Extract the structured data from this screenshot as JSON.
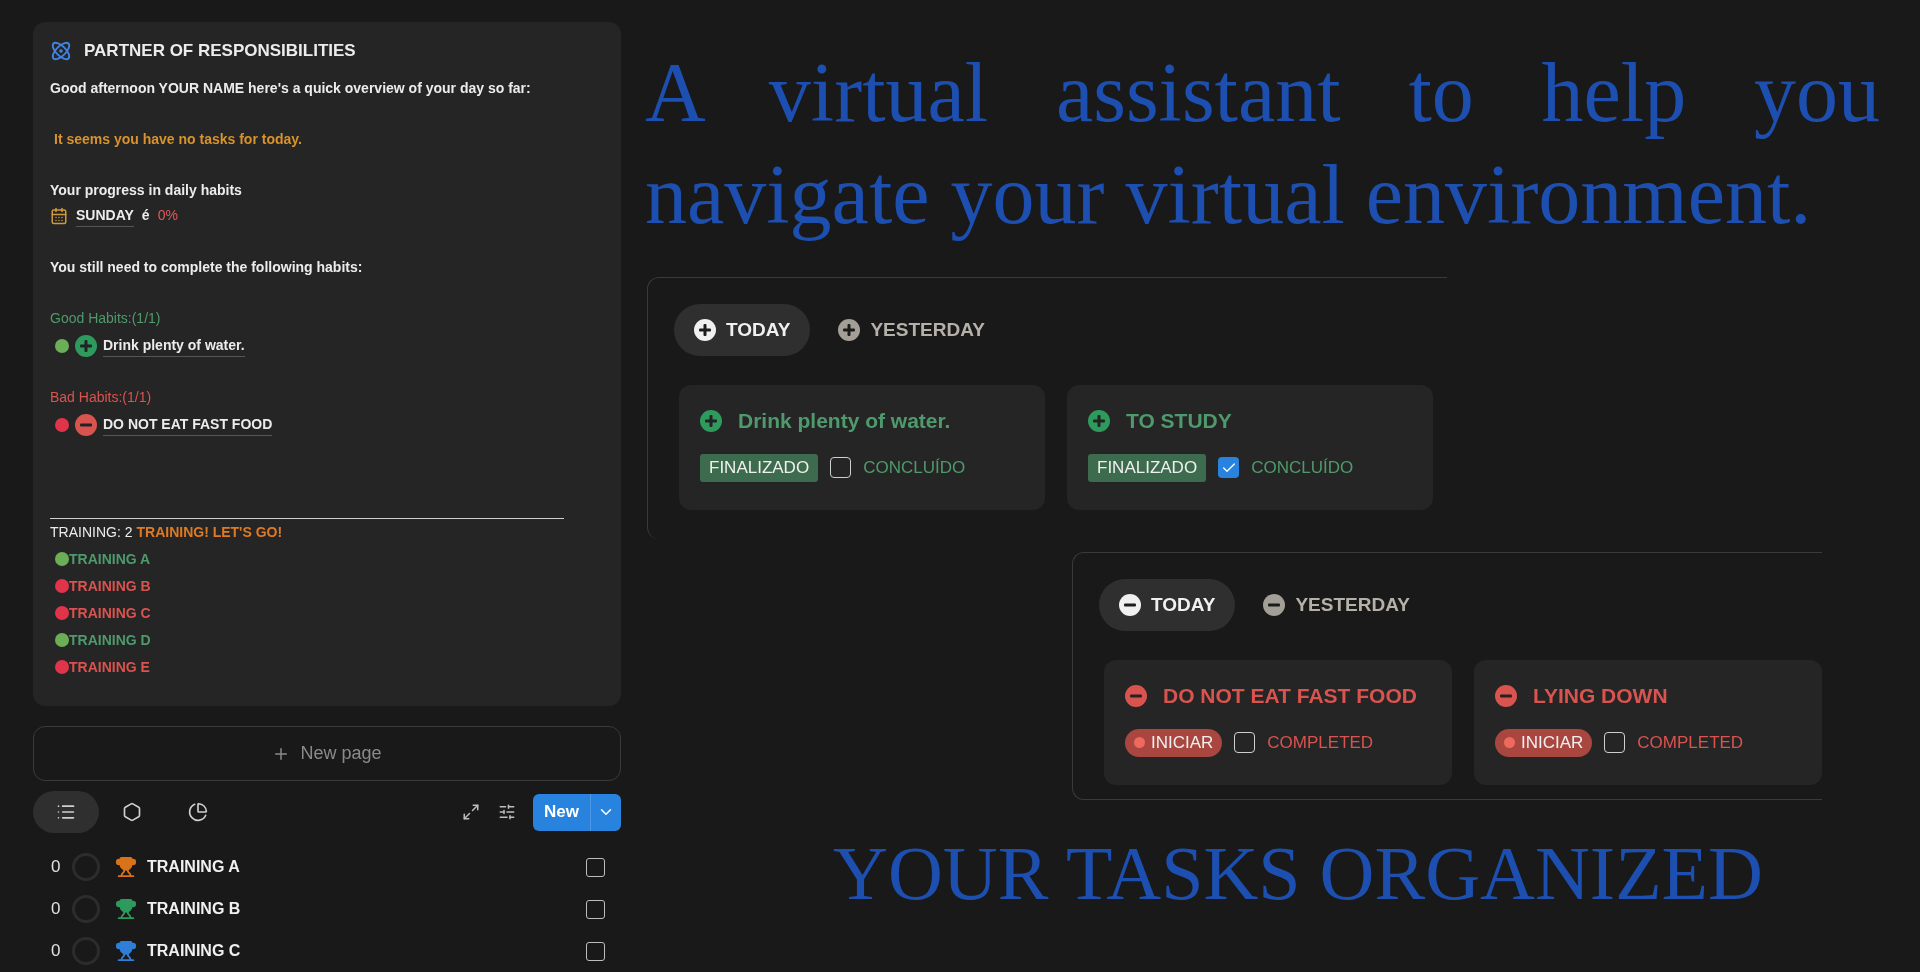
{
  "assistant": {
    "title": "PARTNER OF RESPONSIBILITIES",
    "greeting": "Good afternoon YOUR NAME here's a quick overview of your day so far:",
    "no_tasks": "It seems you have no tasks for today.",
    "progress_label": "Your progress in daily habits",
    "progress": {
      "day": "SUNDAY",
      "connector": "é",
      "percent": "0%"
    },
    "remaining_label": "You still need to complete the following habits:",
    "habit_groups": [
      {
        "kind": "good",
        "label": "Good Habits:(1/1)",
        "items": [
          "Drink plenty of water."
        ]
      },
      {
        "kind": "bad",
        "label": "Bad Habits:(1/1)",
        "items": [
          "DO NOT EAT FAST FOOD"
        ]
      }
    ],
    "training": {
      "label": "TRAINING: 2",
      "cheer": "TRAINING! LET'S GO!",
      "items": [
        {
          "name": "TRAINING A",
          "done": true
        },
        {
          "name": "TRAINING B",
          "done": false
        },
        {
          "name": "TRAINING C",
          "done": false
        },
        {
          "name": "TRAINING D",
          "done": true
        },
        {
          "name": "TRAINING E",
          "done": false
        }
      ]
    }
  },
  "new_page_button": "New page",
  "views": [
    {
      "kind": "list",
      "selected": true
    },
    {
      "kind": "gallery",
      "selected": false
    },
    {
      "kind": "chart",
      "selected": false
    }
  ],
  "new_button": "New",
  "rows": [
    {
      "count": "0",
      "name": "TRAINING A",
      "color": "#d9731a",
      "checked": false
    },
    {
      "count": "0",
      "name": "TRAINING B",
      "color": "#2e9a5e",
      "checked": false
    },
    {
      "count": "0",
      "name": "TRAINING C",
      "color": "#2f7fd8",
      "checked": false
    }
  ],
  "headline": "A virtual assistant to help you navigate your virtual environment.",
  "panels": [
    {
      "kind": "good",
      "tabs": [
        {
          "label": "TODAY",
          "selected": true
        },
        {
          "label": "YESTERDAY",
          "selected": false
        }
      ],
      "cards": [
        {
          "title": "Drink plenty of water.",
          "badge": "FINALIZADO",
          "check_label": "CONCLUÍDO",
          "checked": false
        },
        {
          "title": "TO STUDY",
          "badge": "FINALIZADO",
          "check_label": "CONCLUÍDO",
          "checked": true
        }
      ]
    },
    {
      "kind": "bad",
      "tabs": [
        {
          "label": "TODAY",
          "selected": true
        },
        {
          "label": "YESTERDAY",
          "selected": false
        }
      ],
      "cards": [
        {
          "title": "DO NOT EAT FAST FOOD",
          "badge": "INICIAR",
          "check_label": "COMPLETED",
          "checked": false
        },
        {
          "title": "LYING DOWN",
          "badge": "INICIAR",
          "check_label": "COMPLETED",
          "checked": false
        }
      ]
    }
  ],
  "footer_title": "YOUR TASKS ORGANIZED"
}
